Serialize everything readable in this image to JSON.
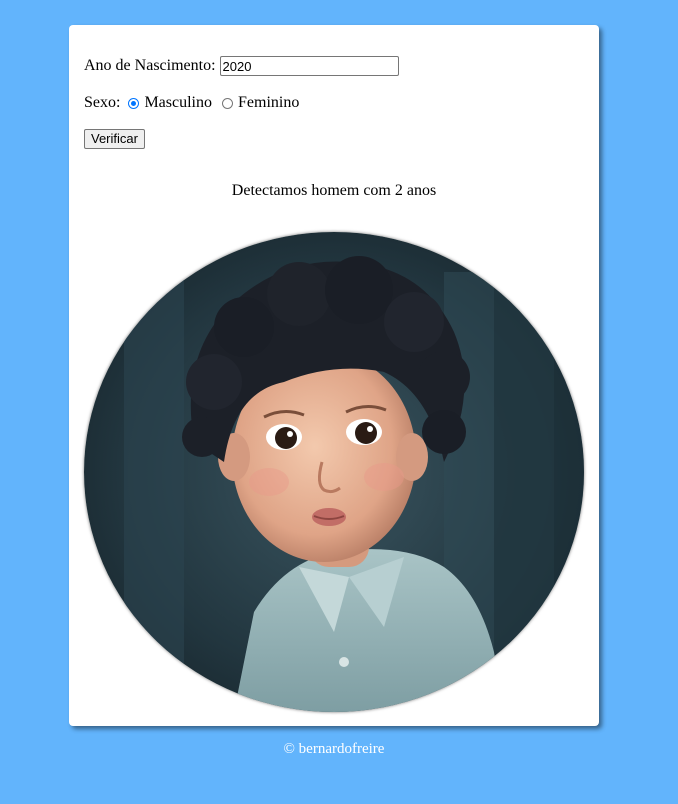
{
  "form": {
    "year_label": "Ano de Nascimento:",
    "year_value": "2020",
    "sex_label": "Sexo:",
    "sex_options": [
      "Masculino",
      "Feminino"
    ],
    "sex_selected": "Masculino",
    "verify_label": "Verificar"
  },
  "result": {
    "text": "Detectamos homem com 2 anos",
    "image_description": "child-boy-photo"
  },
  "footer": {
    "copyright": "© bernardofreire"
  },
  "colors": {
    "background": "#62b4fc",
    "card": "#ffffff",
    "radio_accent": "#0075ff"
  }
}
